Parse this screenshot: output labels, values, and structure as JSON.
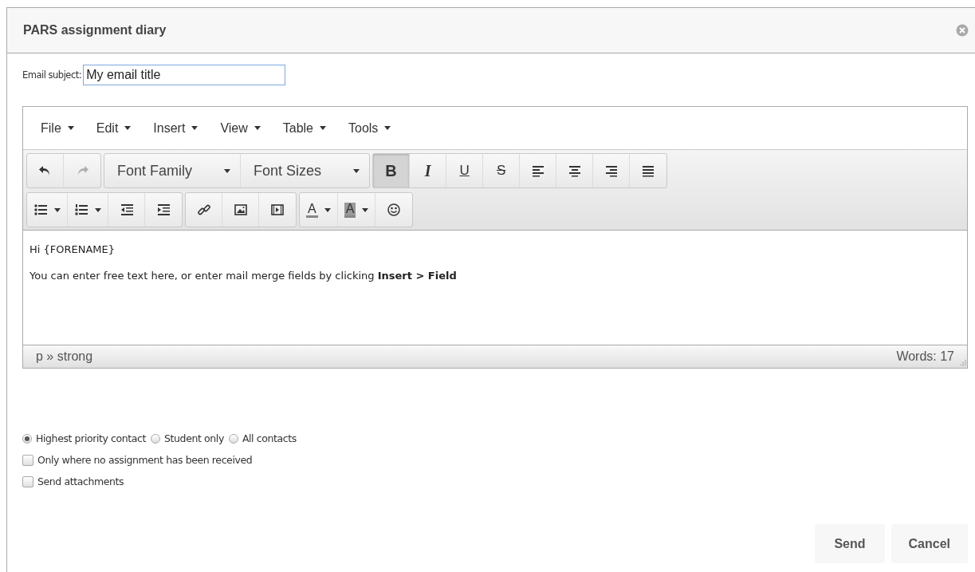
{
  "dialog": {
    "title": "PARS assignment diary"
  },
  "subject": {
    "label": "Email subject:",
    "value": "My email title"
  },
  "editor": {
    "menus": [
      {
        "label": "File"
      },
      {
        "label": "Edit"
      },
      {
        "label": "Insert"
      },
      {
        "label": "View"
      },
      {
        "label": "Table"
      },
      {
        "label": "Tools"
      }
    ],
    "toolbar_rows": [
      [
        [
          {
            "kind": "icon",
            "disabled": false,
            "active": false
          },
          {
            "kind": "icon",
            "disabled": true,
            "active": false
          }
        ],
        [
          {
            "kind": "select",
            "label": "Font Family",
            "disabled": false,
            "active": false
          },
          {
            "kind": "select",
            "label": "Font Sizes",
            "disabled": false,
            "active": false
          }
        ],
        [
          {
            "kind": "bold",
            "label": "B",
            "disabled": false,
            "active": true
          },
          {
            "kind": "italic",
            "label": "I",
            "disabled": false,
            "active": false
          },
          {
            "kind": "underline",
            "label": "U",
            "disabled": false,
            "active": false
          },
          {
            "kind": "strike",
            "label": "S",
            "disabled": false,
            "active": false
          },
          {
            "kind": "icon",
            "disabled": false,
            "active": false
          },
          {
            "kind": "icon",
            "disabled": false,
            "active": false
          },
          {
            "kind": "icon",
            "disabled": false,
            "active": false
          },
          {
            "kind": "icon",
            "disabled": false,
            "active": false
          }
        ]
      ],
      [
        [
          {
            "kind": "split",
            "disabled": false,
            "active": false
          },
          {
            "kind": "split",
            "disabled": false,
            "active": false
          },
          {
            "kind": "icon",
            "disabled": false,
            "active": false
          },
          {
            "kind": "icon",
            "disabled": false,
            "active": false
          }
        ],
        [
          {
            "kind": "icon",
            "disabled": false,
            "active": false
          },
          {
            "kind": "icon",
            "disabled": false,
            "active": false
          },
          {
            "kind": "icon",
            "disabled": false,
            "active": false
          }
        ],
        [
          {
            "kind": "color",
            "label": "A",
            "disabled": false,
            "active": false
          },
          {
            "kind": "color",
            "label": "A",
            "disabled": false,
            "active": false
          },
          {
            "kind": "icon",
            "disabled": false,
            "active": false
          }
        ]
      ]
    ],
    "content": [
      "Hi {FORENAME}",
      "You can enter free text here, or enter mail merge fields by clicking **Insert > Field**"
    ],
    "path": "p » strong",
    "word_count": "Words: 17"
  },
  "recipients": [
    {
      "label": "Highest priority contact",
      "selected": true
    },
    {
      "label": "Student only",
      "selected": false
    },
    {
      "label": "All contacts",
      "selected": false
    }
  ],
  "options": [
    {
      "label": "Only where no assignment has been received",
      "checked": false
    },
    {
      "label": "Send attachments",
      "checked": false
    }
  ],
  "buttons": [
    {
      "label": "Send"
    },
    {
      "label": "Cancel"
    }
  ]
}
